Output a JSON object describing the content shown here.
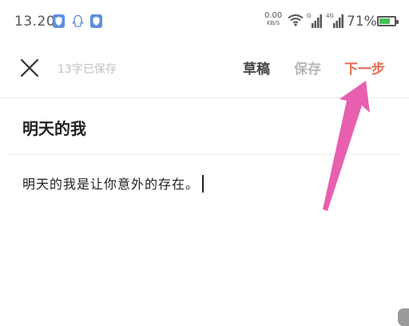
{
  "status_bar": {
    "time": "13.20",
    "net_speed_value": "0.00",
    "net_speed_unit": "KB/S",
    "signal1_label": "G",
    "signal2_label": "4G",
    "battery_percent": "71%",
    "battery_level": 0.71,
    "battery_color": "#45c05a"
  },
  "toolbar": {
    "saved_hint": "13字已保存",
    "draft_label": "草稿",
    "save_label": "保存",
    "next_label": "下一步",
    "next_color": "#e86b52"
  },
  "editor": {
    "title": "明天的我",
    "body": "明天的我是让你意外的存在。"
  },
  "annotation": {
    "arrow_color": "#e85fb0"
  }
}
